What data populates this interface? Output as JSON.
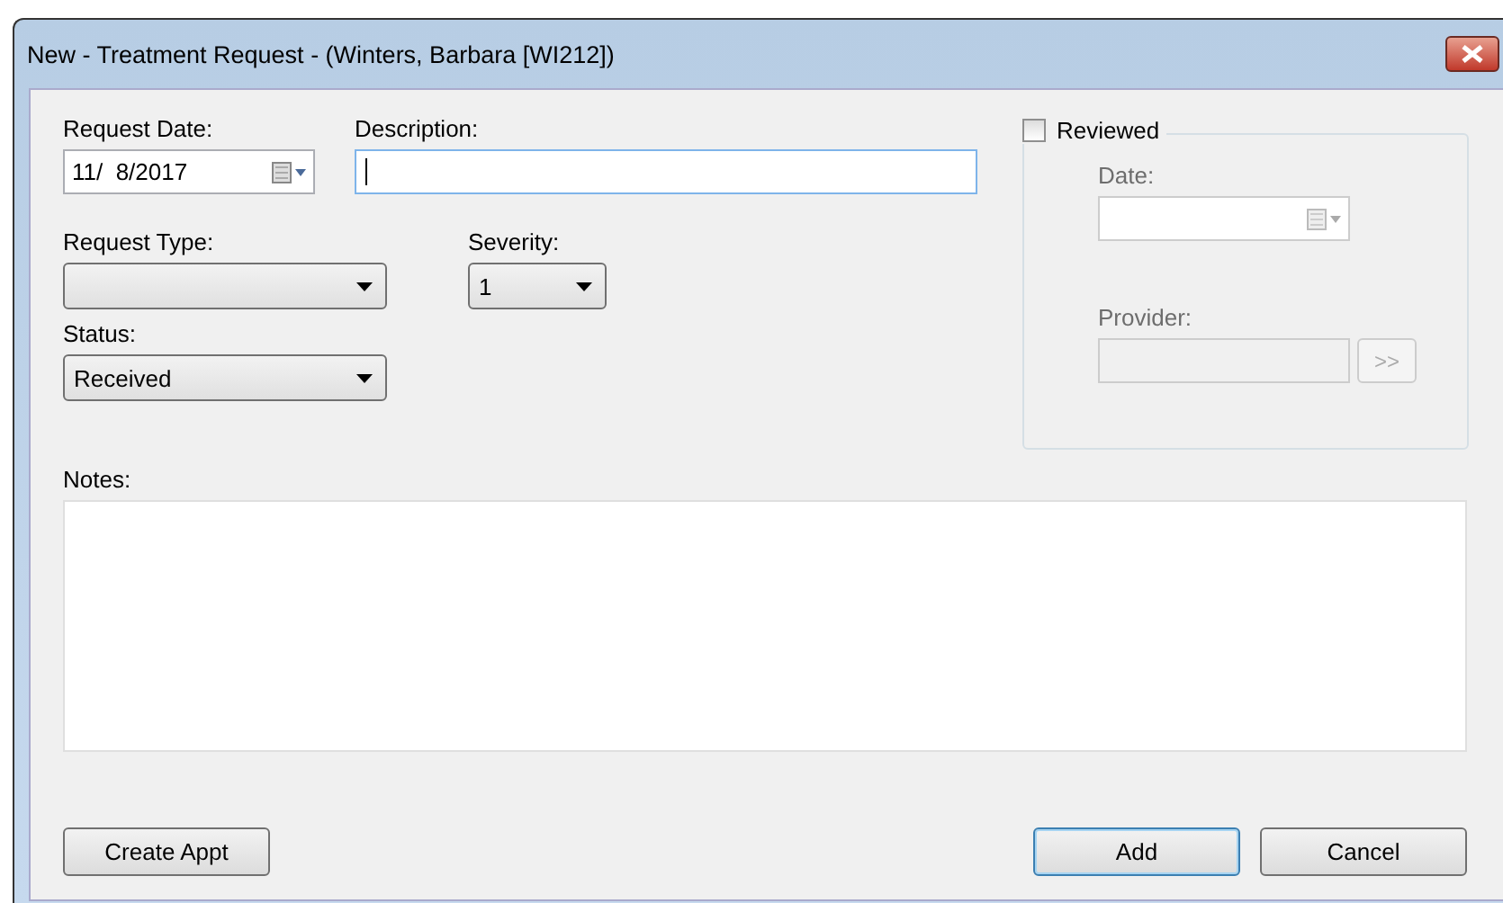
{
  "window": {
    "title": "New - Treatment Request - (Winters, Barbara [WI212])"
  },
  "request_date": {
    "label": "Request Date:",
    "value": "11/  8/2017"
  },
  "description": {
    "label": "Description:",
    "focused": true
  },
  "request_type": {
    "label": "Request Type:"
  },
  "severity": {
    "label": "Severity:",
    "value": "1"
  },
  "status": {
    "label": "Status:",
    "value": "Received"
  },
  "reviewed": {
    "label": "Reviewed",
    "checked": false,
    "date_label": "Date:",
    "provider_label": "Provider:",
    "browse": ">>",
    "disabled": true
  },
  "notes": {
    "label": "Notes:"
  },
  "left_buttons": [
    {
      "label": "Create Appt",
      "default": false
    }
  ],
  "right_buttons": [
    {
      "label": "Add",
      "default": true
    },
    {
      "label": "Cancel",
      "default": false
    }
  ]
}
